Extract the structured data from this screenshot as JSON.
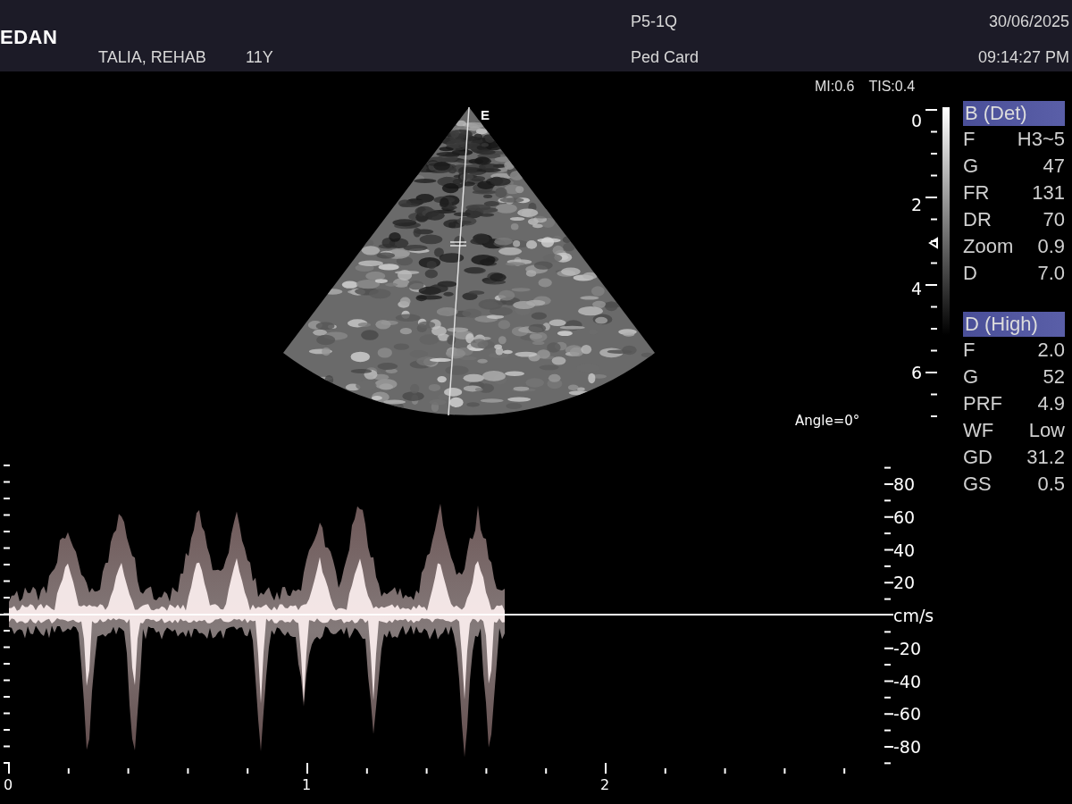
{
  "header": {
    "logo": "EDAN",
    "patient_name": "TALIA, REHAB",
    "patient_age": "11Y",
    "probe": "P5-1Q",
    "exam_preset": "Ped Card",
    "date": "30/06/2025",
    "time": "09:14:27 PM"
  },
  "indices": [
    "MI:0.6",
    "TIS:0.4"
  ],
  "b_mode": {
    "cursor_mark": "E",
    "depth_labels": [
      "0",
      "2",
      "4",
      "6"
    ],
    "angle": "Angle=0°"
  },
  "doppler": {
    "velocity_labels": [
      "80",
      "60",
      "40",
      "20",
      "cm/s",
      "-20",
      "-40",
      "-60",
      "-80"
    ],
    "time_labels": [
      "0",
      "1",
      "2"
    ]
  },
  "params": [
    {
      "title": "B (Det)",
      "rows": [
        {
          "label": "F",
          "value": "H3~5"
        },
        {
          "label": "G",
          "value": "47"
        },
        {
          "label": "FR",
          "value": "131"
        },
        {
          "label": "DR",
          "value": "70"
        },
        {
          "label": "Zoom",
          "value": "0.9"
        },
        {
          "label": "D",
          "value": "7.0"
        }
      ]
    },
    {
      "title": "D (High)",
      "rows": [
        {
          "label": "F",
          "value": "2.0"
        },
        {
          "label": "G",
          "value": "52"
        },
        {
          "label": "PRF",
          "value": "4.9"
        },
        {
          "label": "WF",
          "value": "Low"
        },
        {
          "label": "GD",
          "value": "31.2"
        },
        {
          "label": "GS",
          "value": "0.5"
        }
      ]
    }
  ]
}
